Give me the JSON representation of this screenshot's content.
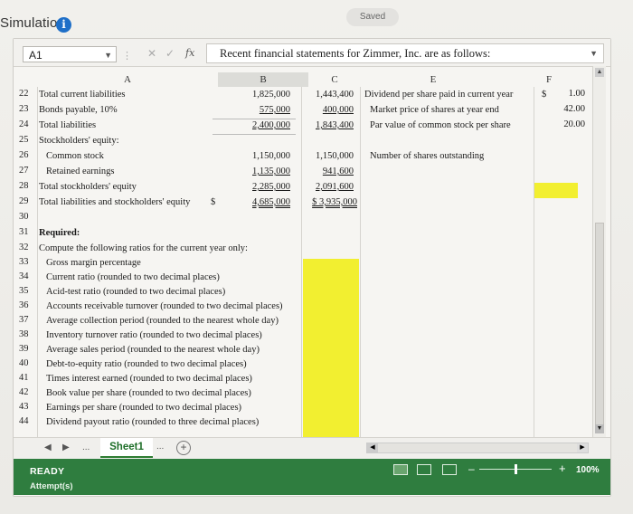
{
  "header": {
    "title": "Simulation",
    "saved": "Saved",
    "info_icon": "info-icon"
  },
  "formula_bar": {
    "name_box": "A1",
    "fx": "fx",
    "content": "Recent financial statements for Zimmer, Inc. are as follows:"
  },
  "columns": [
    "A",
    "B",
    "C",
    "",
    "E",
    "F"
  ],
  "rows": [
    {
      "num": "22",
      "a": "Total current liabilities",
      "b": "1,825,000",
      "c": "1,443,400",
      "e": "Dividend per share paid in current year",
      "f_prefix": "$",
      "f": "1.00"
    },
    {
      "num": "23",
      "a": "Bonds payable, 10%",
      "b": "575,000",
      "c": "400,000",
      "e": "Market price of shares at year end",
      "f": "42.00"
    },
    {
      "num": "24",
      "a": "Total liabilities",
      "b": "2,400,000",
      "c": "1,843,400",
      "e": "Par value of common stock per share",
      "f": "20.00"
    },
    {
      "num": "25",
      "a": "Stockholders' equity:"
    },
    {
      "num": "26",
      "a": "Common stock",
      "b": "1,150,000",
      "c": "1,150,000",
      "e": "Number of shares outstanding"
    },
    {
      "num": "27",
      "a": "Retained earnings",
      "b": "1,135,000",
      "c": "941,600"
    },
    {
      "num": "28",
      "a": "Total stockholders' equity",
      "b": "2,285,000",
      "c": "2,091,600"
    },
    {
      "num": "29",
      "a": "Total liabilities and stockholders' equity",
      "a_dollar": "$",
      "b": "4,685,000",
      "c": "$ 3,935,000"
    },
    {
      "num": "30"
    },
    {
      "num": "31",
      "a": "Required:"
    },
    {
      "num": "32",
      "a": "Compute the following ratios for the current year only:"
    },
    {
      "num": "33",
      "a": "Gross margin percentage"
    },
    {
      "num": "34",
      "a": "Current ratio (rounded to two decimal places)"
    },
    {
      "num": "35",
      "a": "Acid-test ratio (rounded to two decimal places)"
    },
    {
      "num": "36",
      "a": "Accounts receivable turnover (rounded to two decimal places)"
    },
    {
      "num": "37",
      "a": "Average collection period (rounded to the nearest whole day)"
    },
    {
      "num": "38",
      "a": "Inventory turnover ratio (rounded to two decimal places)"
    },
    {
      "num": "39",
      "a": "Average sales period (rounded to the nearest whole day)"
    },
    {
      "num": "40",
      "a": "Debt-to-equity ratio (rounded to two decimal places)"
    },
    {
      "num": "41",
      "a": "Times interest earned (rounded to two decimal places)"
    },
    {
      "num": "42",
      "a": "Book value per share (rounded to two decimal places)"
    },
    {
      "num": "43",
      "a": "Earnings per share (rounded to two decimal places)"
    },
    {
      "num": "44",
      "a": "Dividend payout ratio (rounded to three decimal places)"
    }
  ],
  "tabs": {
    "sheet": "Sheet1",
    "more": "...",
    "add": "+"
  },
  "status": {
    "ready": "READY",
    "attempts": "Attempt(s)",
    "zoom": "100%"
  },
  "colors": {
    "status_green": "#2f7d3f",
    "highlight": "#f2ef30"
  }
}
